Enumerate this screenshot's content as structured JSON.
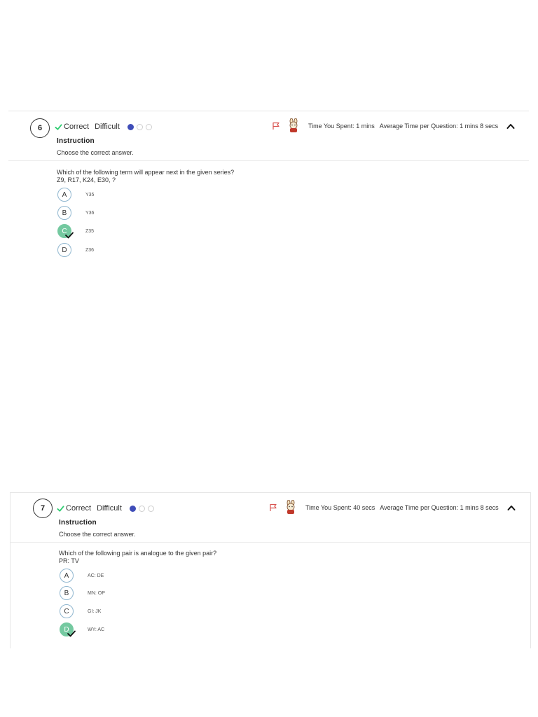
{
  "questions": [
    {
      "number": "6",
      "status": "Correct",
      "difficulty": "Difficult",
      "difficulty_dots": [
        true,
        false,
        false
      ],
      "instruction_title": "Instruction",
      "instruction_text": "Choose the correct answer.",
      "time_spent": "Time You Spent: 1 mins",
      "average_time": "Average Time per Question: 1 mins 8 secs",
      "question_text": "Which of the following term will appear next in the given series?",
      "question_sub": "Z9, R17, K24, E30, ?",
      "options": [
        {
          "letter": "A",
          "text": "Y35",
          "selected": false
        },
        {
          "letter": "B",
          "text": "Y36",
          "selected": false
        },
        {
          "letter": "C",
          "text": "Z35",
          "selected": true
        },
        {
          "letter": "D",
          "text": "Z36",
          "selected": false
        }
      ]
    },
    {
      "number": "7",
      "status": "Correct",
      "difficulty": "Difficult",
      "difficulty_dots": [
        true,
        false,
        false
      ],
      "instruction_title": "Instruction",
      "instruction_text": "Choose the correct answer.",
      "time_spent": "Time You Spent: 40 secs",
      "average_time": "Average Time per Question: 1 mins 8 secs",
      "question_text": "Which of the following pair is analogue to the given pair?",
      "question_sub": "PR: TV",
      "options": [
        {
          "letter": "A",
          "text": "AC: DE",
          "selected": false
        },
        {
          "letter": "B",
          "text": "MN: OP",
          "selected": false
        },
        {
          "letter": "C",
          "text": "GI: JK",
          "selected": false
        },
        {
          "letter": "D",
          "text": "WY: AC",
          "selected": true
        }
      ]
    }
  ],
  "colors": {
    "correct_check": "#2ecc71",
    "difficulty_dot": "#3f4db8",
    "selected_option": "#74c9a0",
    "flag": "#d9534f"
  },
  "icons": {
    "status": "check-icon",
    "flag": "flag-icon",
    "avatar": "mascot-avatar-icon",
    "collapse": "chevron-up-icon",
    "answer_mark": "tick-icon"
  }
}
